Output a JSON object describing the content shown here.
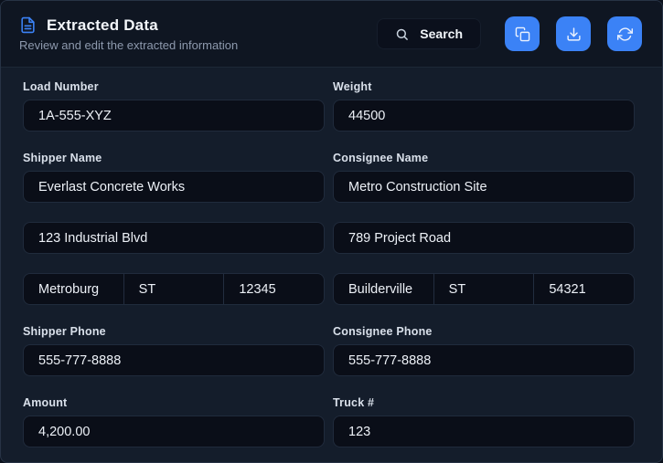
{
  "header": {
    "title": "Extracted Data",
    "subtitle": "Review and edit the extracted information",
    "search_label": "Search",
    "icons": {
      "title_icon": "document-icon",
      "search_icon": "search-icon",
      "copy_icon": "copy-icon",
      "download_icon": "download-icon",
      "refresh_icon": "refresh-icon"
    }
  },
  "colors": {
    "accent_blue": "#3b82f6",
    "header_bg": "#0f1622",
    "body_bg": "#141d2b",
    "input_bg": "#0a0e18"
  },
  "form": {
    "fields": {
      "load_number": {
        "label": "Load Number",
        "value": "1A-555-XYZ"
      },
      "weight": {
        "label": "Weight",
        "value": "44500"
      },
      "shipper_name": {
        "label": "Shipper Name",
        "value": "Everlast Concrete Works"
      },
      "consignee_name": {
        "label": "Consignee Name",
        "value": "Metro Construction Site"
      },
      "shipper_address": {
        "value": "123 Industrial Blvd"
      },
      "consignee_address": {
        "value": "789 Project Road"
      },
      "shipper_city": {
        "value": "Metroburg"
      },
      "shipper_state": {
        "value": "ST"
      },
      "shipper_zip": {
        "value": "12345"
      },
      "consignee_city": {
        "value": "Builderville"
      },
      "consignee_state": {
        "value": "ST"
      },
      "consignee_zip": {
        "value": "54321"
      },
      "shipper_phone": {
        "label": "Shipper Phone",
        "value": "555-777-8888"
      },
      "consignee_phone": {
        "label": "Consignee Phone",
        "value": "555-777-8888"
      },
      "amount": {
        "label": "Amount",
        "value": "4,200.00"
      },
      "truck_number": {
        "label": "Truck #",
        "value": "123"
      }
    }
  }
}
